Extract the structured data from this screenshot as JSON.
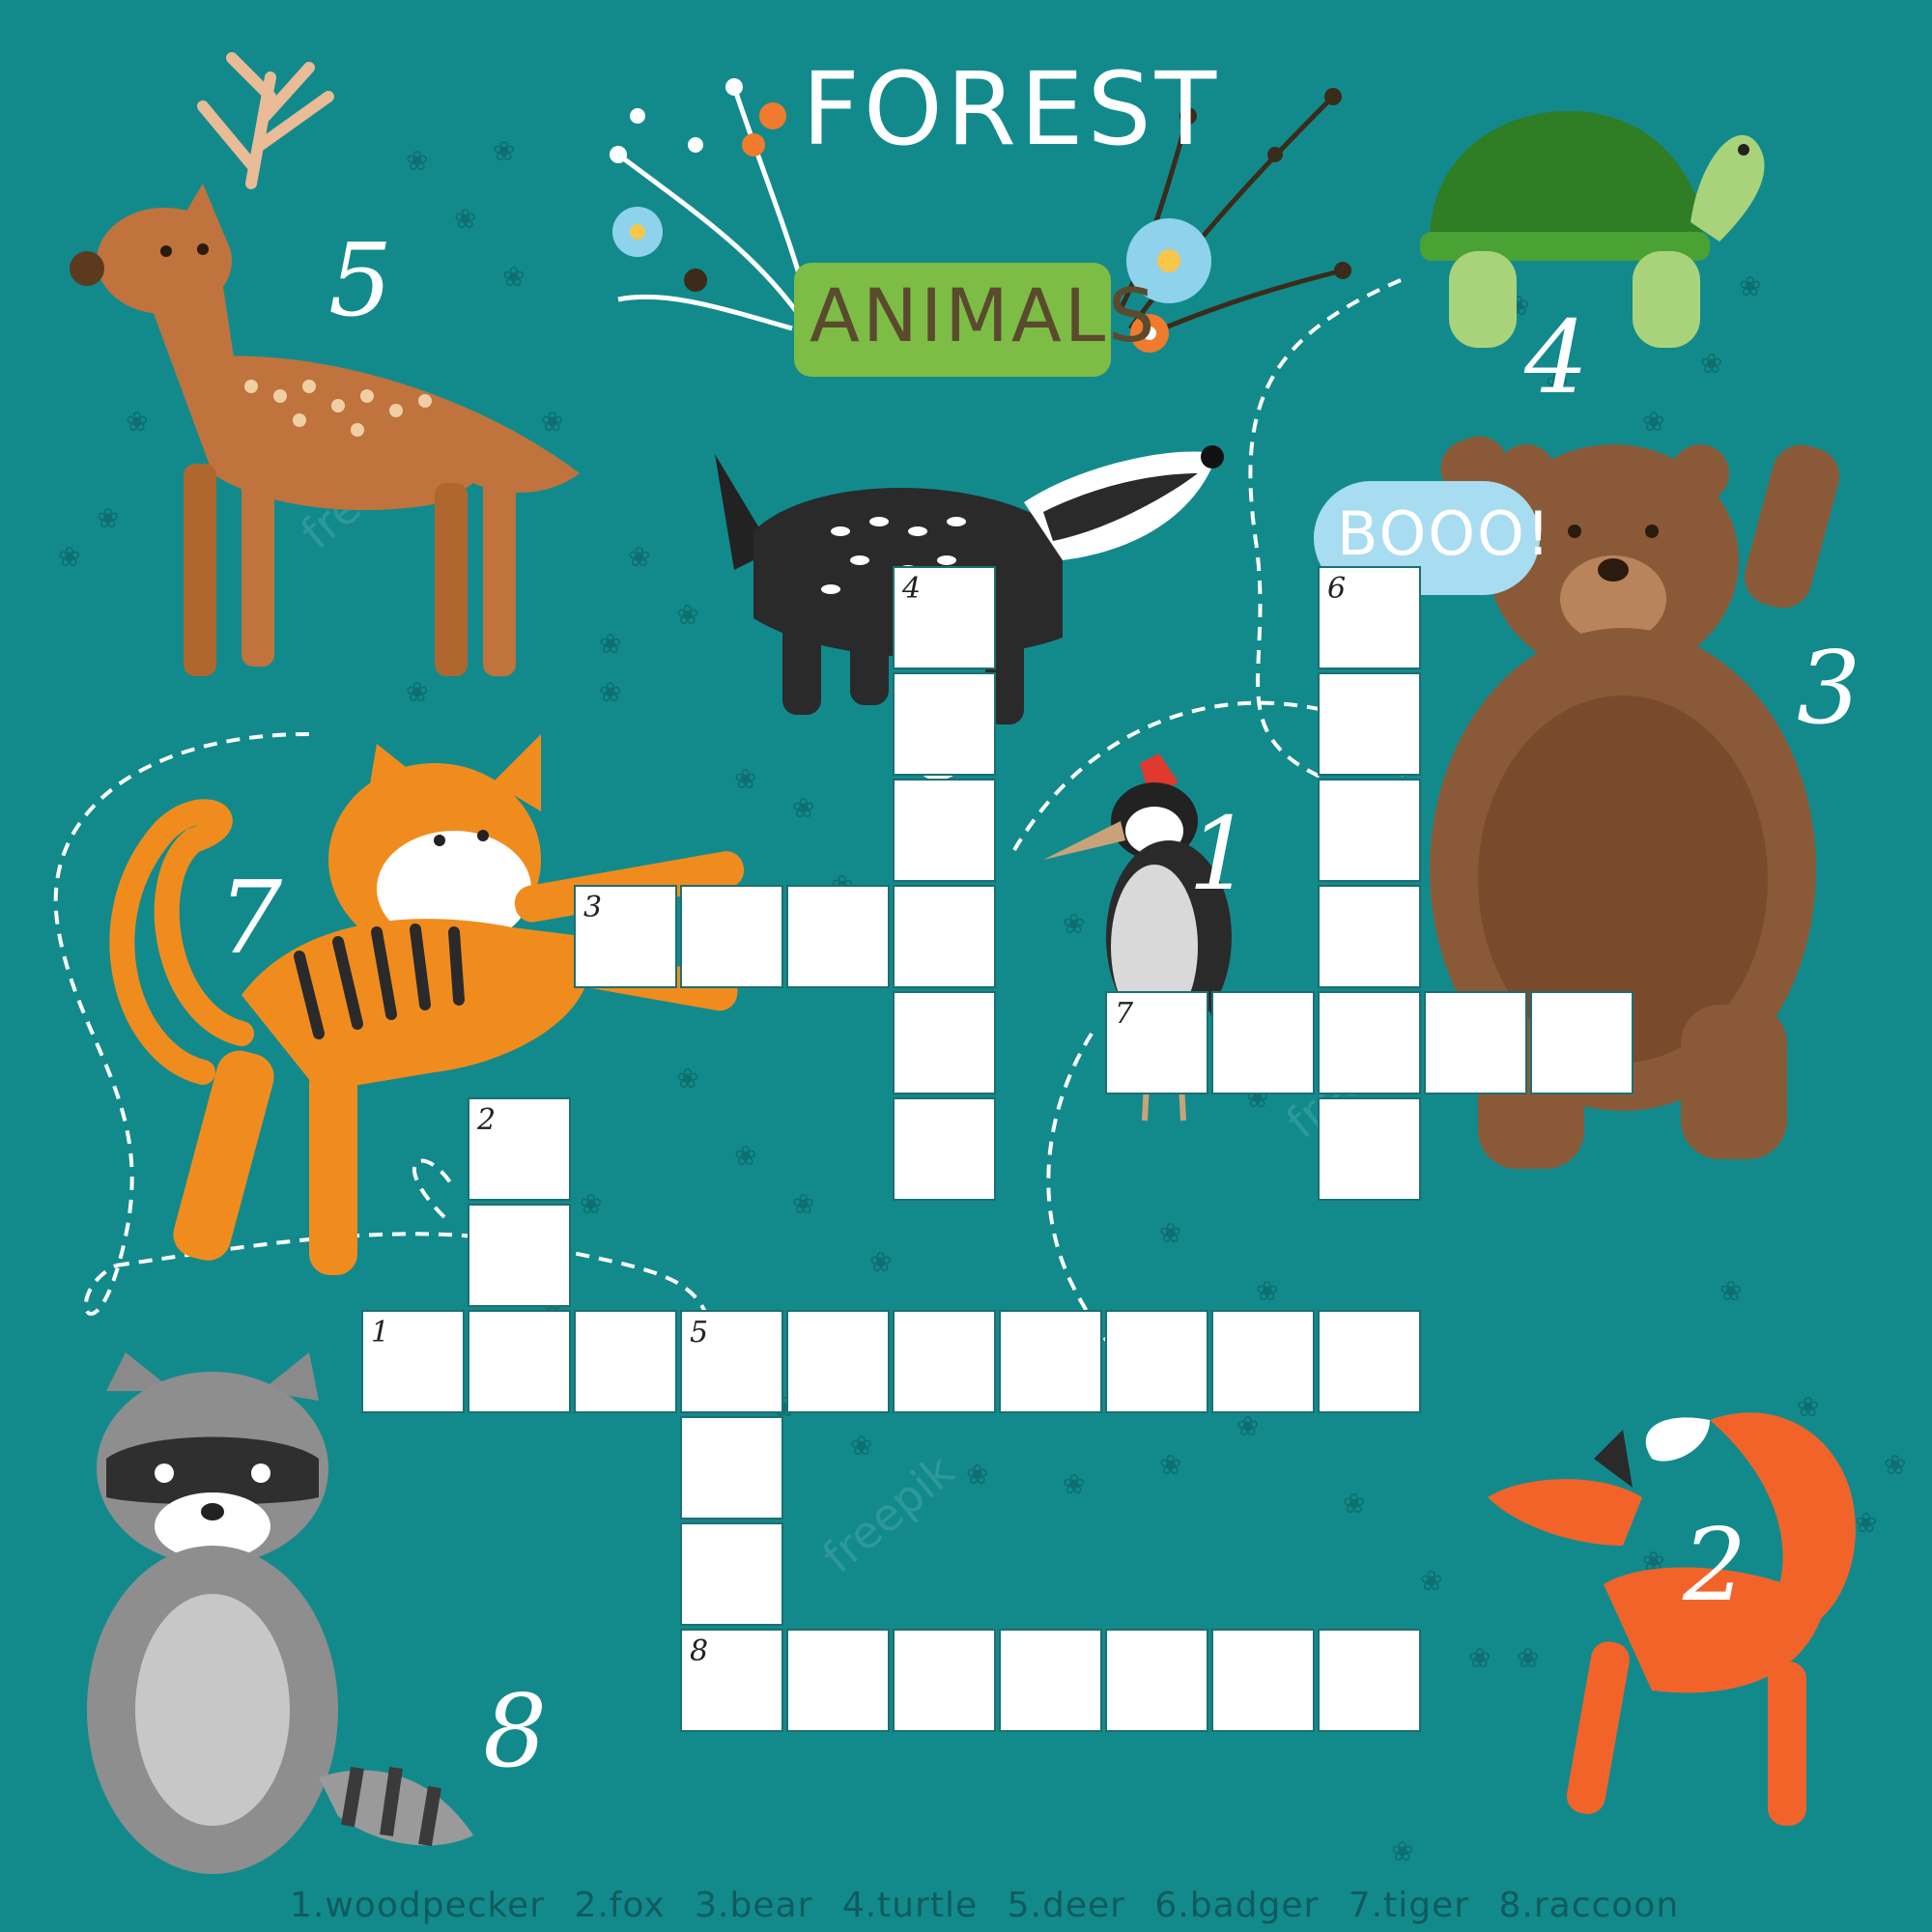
{
  "title": {
    "line1": "FOREST",
    "line2": "ANIMALS"
  },
  "speech_bubble": "BOOO!",
  "watermark": "freepik",
  "animals": [
    {
      "id": "deer",
      "number": "5"
    },
    {
      "id": "turtle",
      "number": "4"
    },
    {
      "id": "badger",
      "number": "6"
    },
    {
      "id": "bear",
      "number": "3"
    },
    {
      "id": "tiger",
      "number": "7"
    },
    {
      "id": "woodpecker",
      "number": "1"
    },
    {
      "id": "raccoon",
      "number": "8"
    },
    {
      "id": "fox",
      "number": "2"
    }
  ],
  "crossword": {
    "clue_numbers": [
      "1",
      "2",
      "3",
      "4",
      "5",
      "6",
      "7",
      "8"
    ],
    "entries": [
      {
        "number": "1",
        "direction": "across",
        "length": 10
      },
      {
        "number": "2",
        "direction": "down",
        "length": 3
      },
      {
        "number": "3",
        "direction": "across",
        "length": 4
      },
      {
        "number": "4",
        "direction": "down",
        "length": 6
      },
      {
        "number": "5",
        "direction": "down",
        "length": 4
      },
      {
        "number": "6",
        "direction": "down",
        "length": 6
      },
      {
        "number": "7",
        "direction": "across",
        "length": 5
      },
      {
        "number": "8",
        "direction": "across",
        "length": 7
      }
    ]
  },
  "answers": [
    "1.woodpecker",
    "2.fox",
    "3.bear",
    "4.turtle",
    "5.deer",
    "6.badger",
    "7.tiger",
    "8.raccoon"
  ],
  "colors": {
    "background": "#128a8c",
    "cell": "#ffffff",
    "title_plate": "#7dbd45",
    "bubble": "#a8dcf0"
  }
}
